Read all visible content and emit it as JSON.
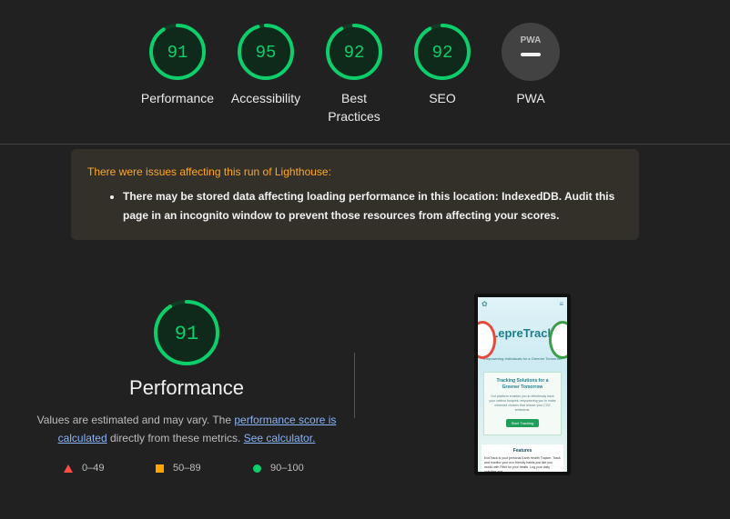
{
  "scores": [
    {
      "value": "91",
      "label": "Performance",
      "fraction": 0.91
    },
    {
      "value": "95",
      "label": "Accessibility",
      "fraction": 0.95
    },
    {
      "value": "92",
      "label_line1": "Best",
      "label_line2": "Practices",
      "fraction": 0.92
    },
    {
      "value": "92",
      "label": "SEO",
      "fraction": 0.92
    },
    {
      "badge": "PWA",
      "label": "PWA"
    }
  ],
  "warning": {
    "title": "There were issues affecting this run of Lighthouse:",
    "item": "There may be stored data affecting loading performance in this location: IndexedDB. Audit this page in an incognito window to prevent those resources from affecting your scores."
  },
  "performance": {
    "score": "91",
    "fraction": 0.91,
    "title": "Performance",
    "desc_prefix": "Values are estimated and may vary. The ",
    "link_score": "performance score is calculated",
    "desc_middle": " directly from these metrics. ",
    "link_calc": "See calculator."
  },
  "legend": {
    "fail": "0–49",
    "average": "50–89",
    "pass": "90–100"
  },
  "screenshot": {
    "brand": "LepreTrack",
    "tagline": "Empowering Individuals for a Greener Tomorrow",
    "card_title": "Tracking Solutions for a Greener Tomorrow",
    "card_text": "Our platform enables you to effortlessly track your carbon footprint, empowering you to make informed choices that reduce your CO2 emissions.",
    "button": "Start Tracking",
    "features_title": "Features",
    "features_text": "EcoTrack is your personal Earth Health Tracker. Track and monitor your eco-friendly habits just like you would with Fitbit for your health. Log your daily activities and"
  },
  "colors": {
    "pass": "#0cce6b",
    "average": "#ffa400",
    "fail": "#ff4e42",
    "warning_title": "#ffa726"
  }
}
